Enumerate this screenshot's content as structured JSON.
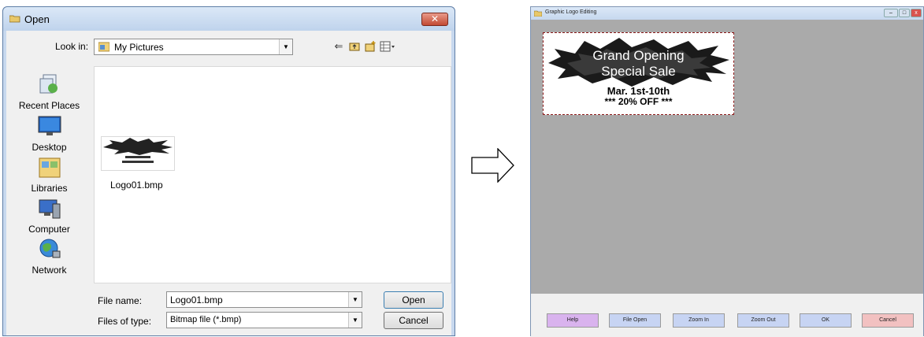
{
  "open_dialog": {
    "title": "Open",
    "close_label": "✕",
    "look_in_label": "Look in:",
    "look_in_value": "My Pictures",
    "places": [
      {
        "label": "Recent Places",
        "icon": "recent-places-icon"
      },
      {
        "label": "Desktop",
        "icon": "desktop-icon"
      },
      {
        "label": "Libraries",
        "icon": "libraries-icon"
      },
      {
        "label": "Computer",
        "icon": "computer-icon"
      },
      {
        "label": "Network",
        "icon": "network-icon"
      }
    ],
    "files": [
      {
        "name": "Logo01.bmp"
      }
    ],
    "file_name_label": "File name:",
    "file_name_value": "Logo01.bmp",
    "file_type_label": "Files of type:",
    "file_type_value": "Bitmap file (*.bmp)",
    "open_button": "Open",
    "cancel_button": "Cancel"
  },
  "logo_window": {
    "title": "Graphic Logo Editing",
    "logo": {
      "line1": "Grand Opening",
      "line2": "Special Sale",
      "line3": "Mar. 1st-10th",
      "line4": "*** 20% OFF ***"
    },
    "buttons": [
      {
        "label": "Help",
        "color": "#d9b3ee"
      },
      {
        "label": "File Open",
        "color": "#c7d4f3"
      },
      {
        "label": "Zoom In",
        "color": "#c7d4f3"
      },
      {
        "label": "Zoom Out",
        "color": "#c7d4f3"
      },
      {
        "label": "OK",
        "color": "#c7d4f3"
      },
      {
        "label": "Cancel",
        "color": "#f2c1c1"
      }
    ]
  }
}
